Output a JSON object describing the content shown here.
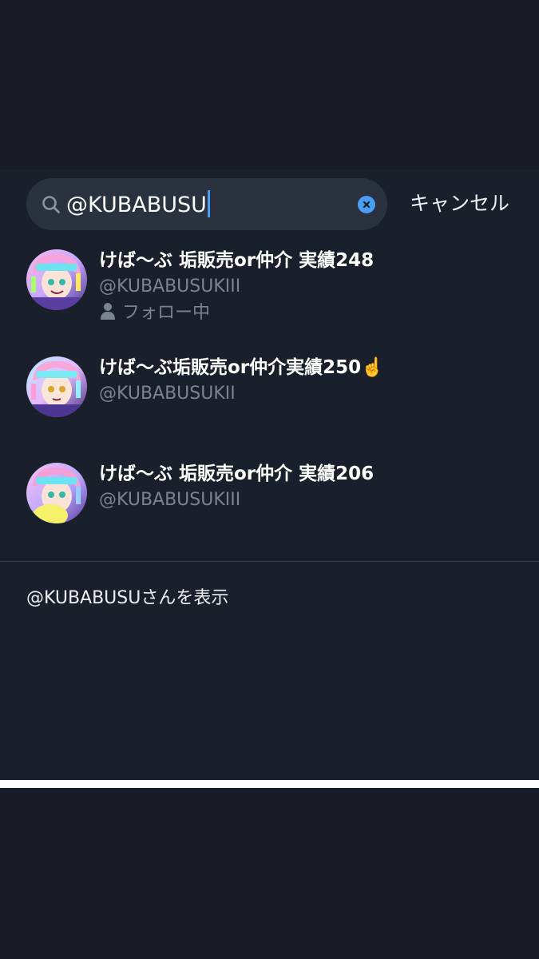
{
  "search": {
    "query": "@KUBABUSU",
    "cancel_label": "キャンセル"
  },
  "results": [
    {
      "name": "けば〜ぶ 垢販売or仲介 実績248",
      "handle": "@KUBABUSUKIII",
      "follow_status": "フォロー中"
    },
    {
      "name": "けば〜ぶ垢販売or仲介実績250☝️",
      "handle": "@KUBABUSUKII"
    },
    {
      "name": "けば〜ぶ 垢販売or仲介 実績206",
      "handle": "@KUBABUSUKIII"
    }
  ],
  "show_user_label": "@KUBABUSUさんを表示",
  "colors": {
    "background": "#161b26",
    "panel": "#1a202b",
    "search_field": "#2a3240",
    "accent": "#4a9df2",
    "secondary_text": "#7b8390"
  }
}
